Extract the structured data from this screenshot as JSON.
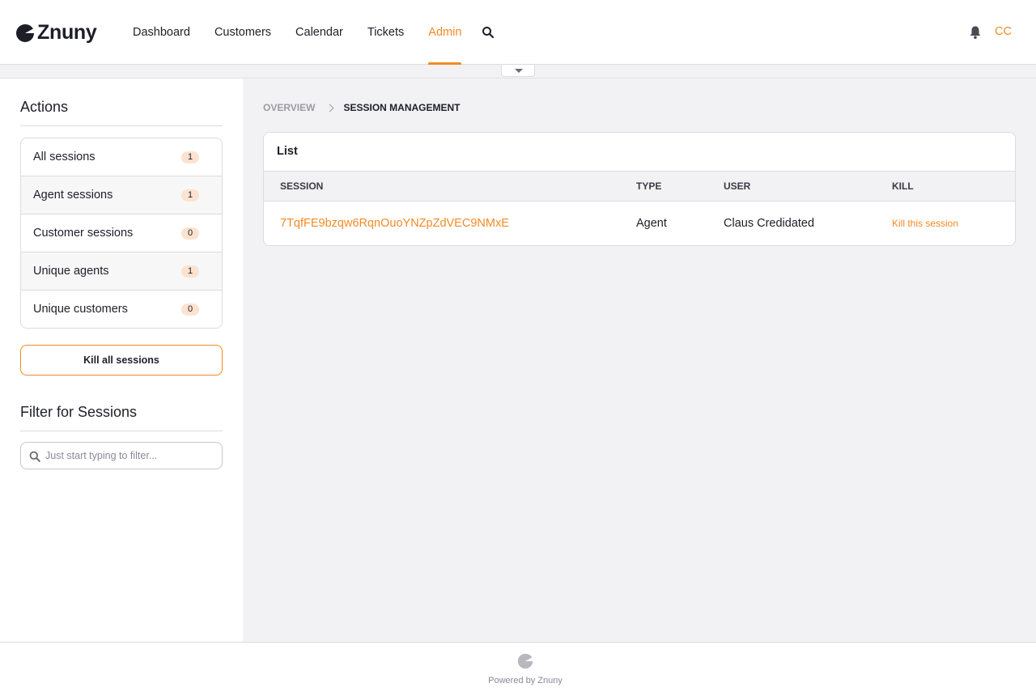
{
  "brand": {
    "name": "Znuny",
    "accent": "#f28a24",
    "logo_icon": "znuny-logo-icon"
  },
  "nav": {
    "items": [
      {
        "label": "Dashboard",
        "active": false
      },
      {
        "label": "Customers",
        "active": false
      },
      {
        "label": "Calendar",
        "active": false
      },
      {
        "label": "Tickets",
        "active": false
      },
      {
        "label": "Admin",
        "active": true
      }
    ],
    "search_icon": "search-icon",
    "notification_icon": "bell-icon",
    "avatar_initials": "CC"
  },
  "sidebar": {
    "actions_heading": "Actions",
    "actions": [
      {
        "label": "All sessions",
        "count": "1"
      },
      {
        "label": "Agent sessions",
        "count": "1"
      },
      {
        "label": "Customer sessions",
        "count": "0"
      },
      {
        "label": "Unique agents",
        "count": "1"
      },
      {
        "label": "Unique customers",
        "count": "0"
      }
    ],
    "kill_all_label": "Kill all sessions",
    "filter_heading": "Filter for Sessions",
    "filter_placeholder": "Just start typing to filter..."
  },
  "breadcrumb": {
    "overview": "OVERVIEW",
    "current": "SESSION MANAGEMENT"
  },
  "list": {
    "title": "List",
    "columns": [
      "SESSION",
      "TYPE",
      "USER",
      "KILL"
    ],
    "rows": [
      {
        "session": "7TqfFE9bzqw6RqnOuoYNZpZdVEC9NMxE",
        "type": "Agent",
        "user": "Claus Credidated",
        "kill": "Kill this session"
      }
    ]
  },
  "footer": {
    "text": "Powered by Znuny"
  }
}
